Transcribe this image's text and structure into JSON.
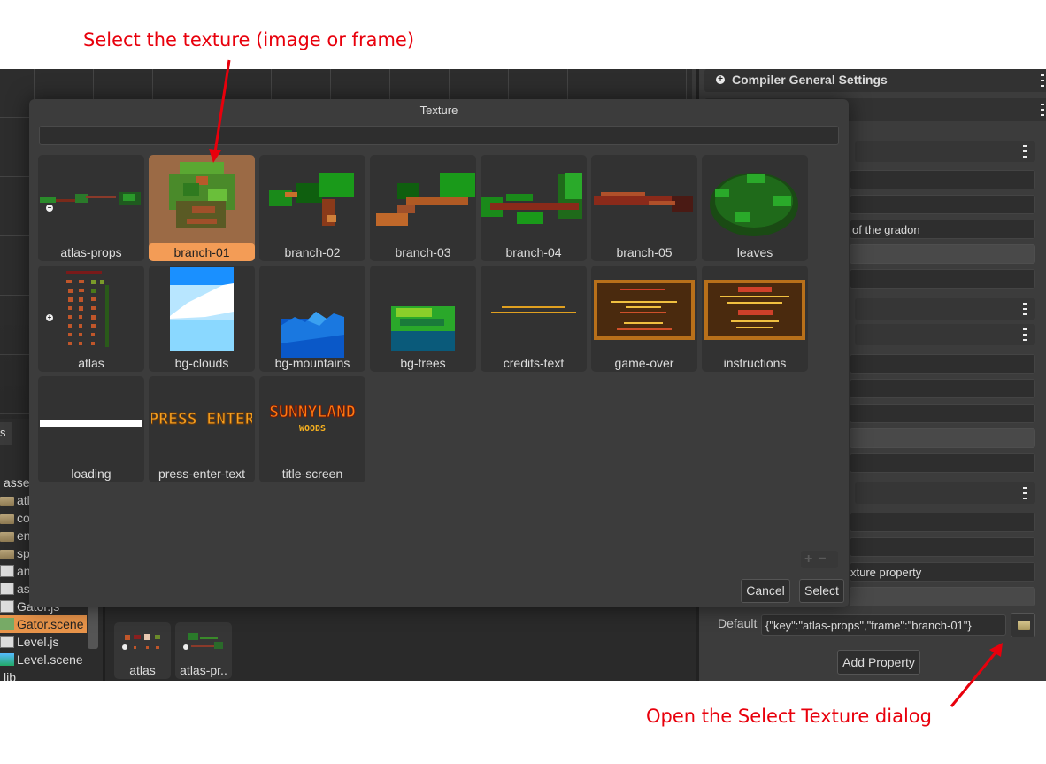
{
  "annotations": {
    "top": "Select the texture (image or frame)",
    "bottom": "Open the Select Texture dialog",
    "color": "#e8000c"
  },
  "dialog": {
    "title": "Texture",
    "search_value": "",
    "tiles": [
      {
        "label": "atlas-props",
        "kind": "atlas",
        "expanded": true,
        "selected": false
      },
      {
        "label": "branch-01",
        "kind": "frame",
        "selected": true
      },
      {
        "label": "branch-02",
        "kind": "frame",
        "selected": false
      },
      {
        "label": "branch-03",
        "kind": "frame",
        "selected": false
      },
      {
        "label": "branch-04",
        "kind": "frame",
        "selected": false
      },
      {
        "label": "branch-05",
        "kind": "frame",
        "selected": false
      },
      {
        "label": "leaves",
        "kind": "frame",
        "selected": false
      },
      {
        "label": "atlas",
        "kind": "atlas",
        "expanded": false,
        "selected": false
      },
      {
        "label": "bg-clouds",
        "kind": "image",
        "selected": false
      },
      {
        "label": "bg-mountains",
        "kind": "image",
        "selected": false
      },
      {
        "label": "bg-trees",
        "kind": "image",
        "selected": false
      },
      {
        "label": "credits-text",
        "kind": "image",
        "selected": false
      },
      {
        "label": "game-over",
        "kind": "image",
        "selected": false
      },
      {
        "label": "instructions",
        "kind": "image",
        "selected": false
      },
      {
        "label": "loading",
        "kind": "image",
        "selected": false
      },
      {
        "label": "press-enter-text",
        "kind": "image",
        "selected": false
      },
      {
        "label": "title-screen",
        "kind": "image",
        "selected": false
      }
    ],
    "zoom_in_label": "+",
    "zoom_out_label": "−",
    "cancel_label": "Cancel",
    "select_label": "Select",
    "selected_accent": "#f39c56"
  },
  "inspector": {
    "section_title": "Compiler General Settings",
    "field_partial_1": "of the gradon",
    "field_partial_2": "xture property",
    "default_label": "Default",
    "default_value": "{\"key\":\"atlas-props\",\"frame\":\"branch-01\"}",
    "add_property_label": "Add Property"
  },
  "files": {
    "tab_label": "s",
    "items": [
      {
        "label": "asse",
        "icon": "none",
        "selected": false
      },
      {
        "label": "atl",
        "icon": "folder-icon",
        "selected": false
      },
      {
        "label": "co",
        "icon": "folder-icon",
        "selected": false
      },
      {
        "label": "en",
        "icon": "folder-icon",
        "selected": false
      },
      {
        "label": "sp",
        "icon": "folder-icon",
        "selected": false
      },
      {
        "label": "an",
        "icon": "animation-icon",
        "selected": false
      },
      {
        "label": "as",
        "icon": "asset-pack-icon",
        "selected": false
      },
      {
        "label": "Gator.js",
        "icon": "js-file-icon",
        "selected": false
      },
      {
        "label": "Gator.scene",
        "icon": "scene-file-icon",
        "selected": true
      },
      {
        "label": "Level.js",
        "icon": "js-file-icon",
        "selected": false
      },
      {
        "label": "Level.scene",
        "icon": "scene-file-icon",
        "selected": false
      },
      {
        "label": "lib",
        "icon": "none",
        "selected": false
      }
    ]
  },
  "assets_panel": {
    "items": [
      {
        "label": "atlas"
      },
      {
        "label": "atlas-pr.."
      }
    ]
  }
}
